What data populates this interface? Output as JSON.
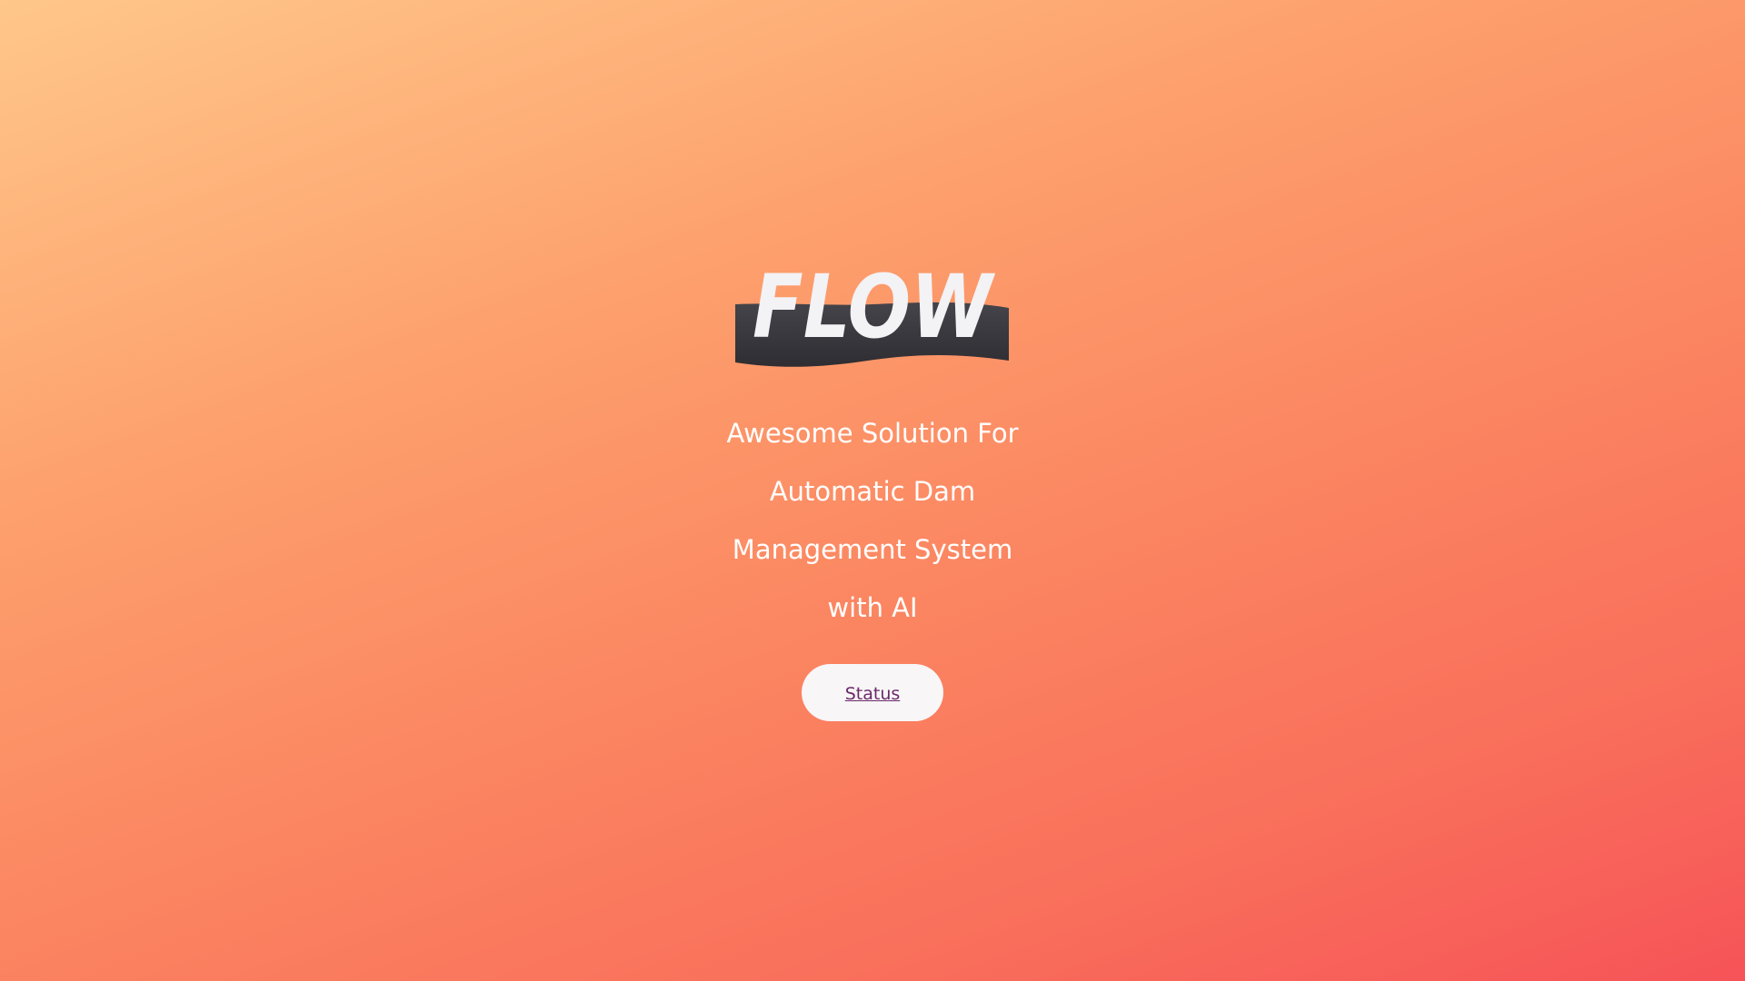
{
  "logo": {
    "text": "FLOW",
    "text_color": "#f3f2f4",
    "wave_color": "#3b3a3f"
  },
  "tagline": {
    "lines": [
      "Awesome Solution For",
      "Automatic Dam",
      "Management System",
      "with AI"
    ]
  },
  "status_button": {
    "label": "Status"
  },
  "colors": {
    "background_start": "#ffc78a",
    "background_end": "#f65358",
    "button_bg": "#f8f6f7",
    "link": "#6a2a6a",
    "text": "#ffffff"
  }
}
